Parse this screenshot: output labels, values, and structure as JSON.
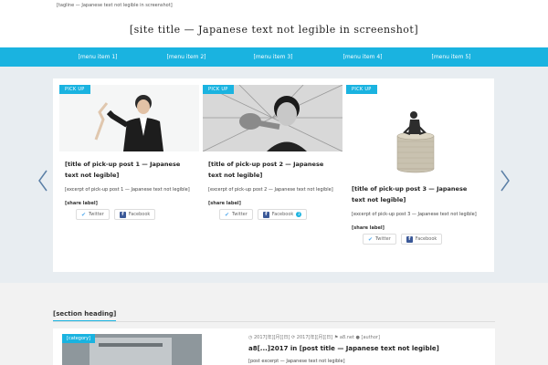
{
  "topbar": {
    "tagline": "[tagline — Japanese text not legible in screenshot]"
  },
  "header": {
    "site_title": "[site title — Japanese text not legible in screenshot]"
  },
  "nav": {
    "items": [
      {
        "label": "[menu item 1]"
      },
      {
        "label": "[menu item 2]"
      },
      {
        "label": "[menu item 3]"
      },
      {
        "label": "[menu item 4]"
      },
      {
        "label": "[menu item 5]"
      }
    ]
  },
  "slider": {
    "cards": [
      {
        "badge": "PICK UP",
        "title": "[title of pick-up post 1 — Japanese text not legible]",
        "excerpt": "[excerpt of pick-up post 1 — Japanese text not legible]",
        "share_label": "[share label]",
        "twitter_label": "Twitter",
        "facebook_label": "Facebook"
      },
      {
        "badge": "PICK UP",
        "title": "[title of pick-up post 2 — Japanese text not legible]",
        "excerpt": "[excerpt of pick-up post 2 — Japanese text not legible]",
        "share_label": "[share label]",
        "twitter_label": "Twitter",
        "facebook_label": "Facebook",
        "facebook_count": "3"
      },
      {
        "badge": "PICK UP",
        "title": "[title of pick-up post 3 — Japanese text not legible]",
        "excerpt": "[excerpt of pick-up post 3 — Japanese text not legible]",
        "share_label": "[share label]",
        "twitter_label": "Twitter",
        "facebook_label": "Facebook"
      }
    ]
  },
  "section": {
    "label": "[section heading]"
  },
  "post": {
    "category": "[category]",
    "date_published": "2017[年][月][日]",
    "date_updated": "2017[年][月][日]",
    "tag": "a8.net",
    "author": "[author]",
    "title": "a8[...]2017 in [post title — Japanese text not legible]",
    "excerpt": "[post excerpt — Japanese text not legible]"
  },
  "colors": {
    "accent": "#1ab3e0",
    "slider_band": "#e8edf1",
    "twitter": "#55acee",
    "facebook": "#3b5998"
  }
}
